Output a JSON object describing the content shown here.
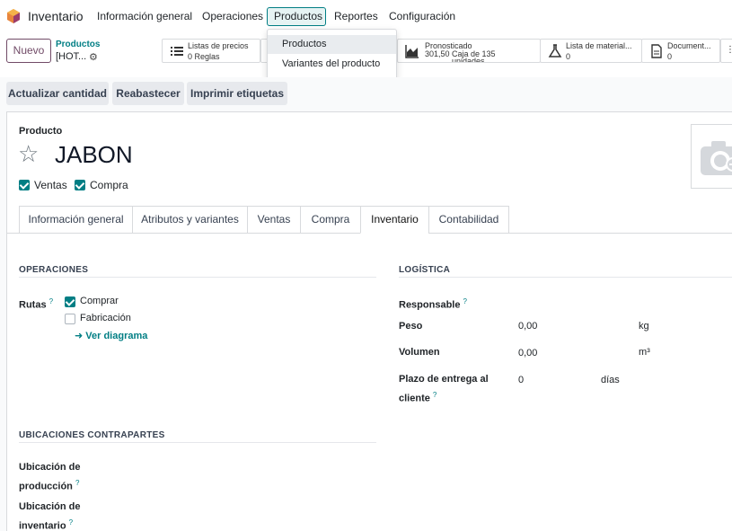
{
  "app": {
    "name": "Inventario"
  },
  "nav": {
    "items": [
      "Información general",
      "Operaciones",
      "Productos",
      "Reportes",
      "Configuración"
    ]
  },
  "dropdown": {
    "items": [
      "Productos",
      "Variantes del producto"
    ]
  },
  "control": {
    "new_label": "Nuevo",
    "breadcrumb_parent": "Productos",
    "breadcrumb_current": "[HOT..."
  },
  "smart_buttons": {
    "pricelists": {
      "title": "Listas de precios",
      "value": "0 Reglas"
    },
    "forecast": {
      "title": "Pronosticado",
      "value": "301,50 Caja de 135",
      "value2": "unidades"
    },
    "bom": {
      "title": "Lista de material...",
      "value": "0"
    },
    "documents": {
      "title": "Document...",
      "value": "0"
    }
  },
  "actions": [
    "Actualizar cantidad",
    "Reabastecer",
    "Imprimir etiquetas"
  ],
  "product": {
    "label": "Producto",
    "name": "JABON",
    "sale_label": "Ventas",
    "purchase_label": "Compra"
  },
  "tabs": [
    "Información general",
    "Atributos y variantes",
    "Ventas",
    "Compra",
    "Inventario",
    "Contabilidad"
  ],
  "operations": {
    "title": "OPERACIONES",
    "routes_label": "Rutas",
    "help": "?",
    "route_buy": "Comprar",
    "route_manufacture": "Fabricación",
    "diagram_link": "Ver diagrama"
  },
  "logistics": {
    "title": "LOGÍSTICA",
    "responsible_label": "Responsable",
    "weight_label": "Peso",
    "weight_value": "0,00",
    "weight_unit": "kg",
    "volume_label": "Volumen",
    "volume_value": "0,00",
    "volume_unit": "m³",
    "lead_label_1": "Plazo de entrega al",
    "lead_label_2": "cliente",
    "lead_value": "0",
    "lead_unit": "días"
  },
  "counterparts": {
    "title": "UBICACIONES CONTRAPARTES",
    "production_1": "Ubicación de",
    "production_2": "producción",
    "inventory_1": "Ubicación de",
    "inventory_2": "inventario"
  },
  "colors": {
    "accent": "#017e84",
    "brand": "#714b67"
  }
}
